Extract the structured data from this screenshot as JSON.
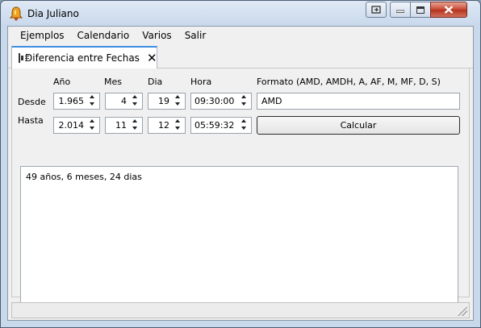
{
  "window": {
    "title": "Dia Juliano"
  },
  "menu": [
    "Ejemplos",
    "Calendario",
    "Varios",
    "Salir"
  ],
  "tab": {
    "label": "Diferencia entre Fechas"
  },
  "columns": {
    "anio": "Año",
    "mes": "Mes",
    "dia": "Dia",
    "hora": "Hora",
    "formato": "Formato (AMD, AMDH, A, AF, M, MF, D, S)"
  },
  "desde": {
    "label": "Desde",
    "anio": "1.965",
    "mes": "4",
    "dia": "19",
    "hora": "09:30:00"
  },
  "hasta": {
    "label": "Hasta",
    "anio": "2.014",
    "mes": "11",
    "dia": "12",
    "hora": "05:59:32"
  },
  "formato_value": "AMD",
  "calc_label": "Calcular",
  "result": "49 años, 6 meses, 24 dias"
}
